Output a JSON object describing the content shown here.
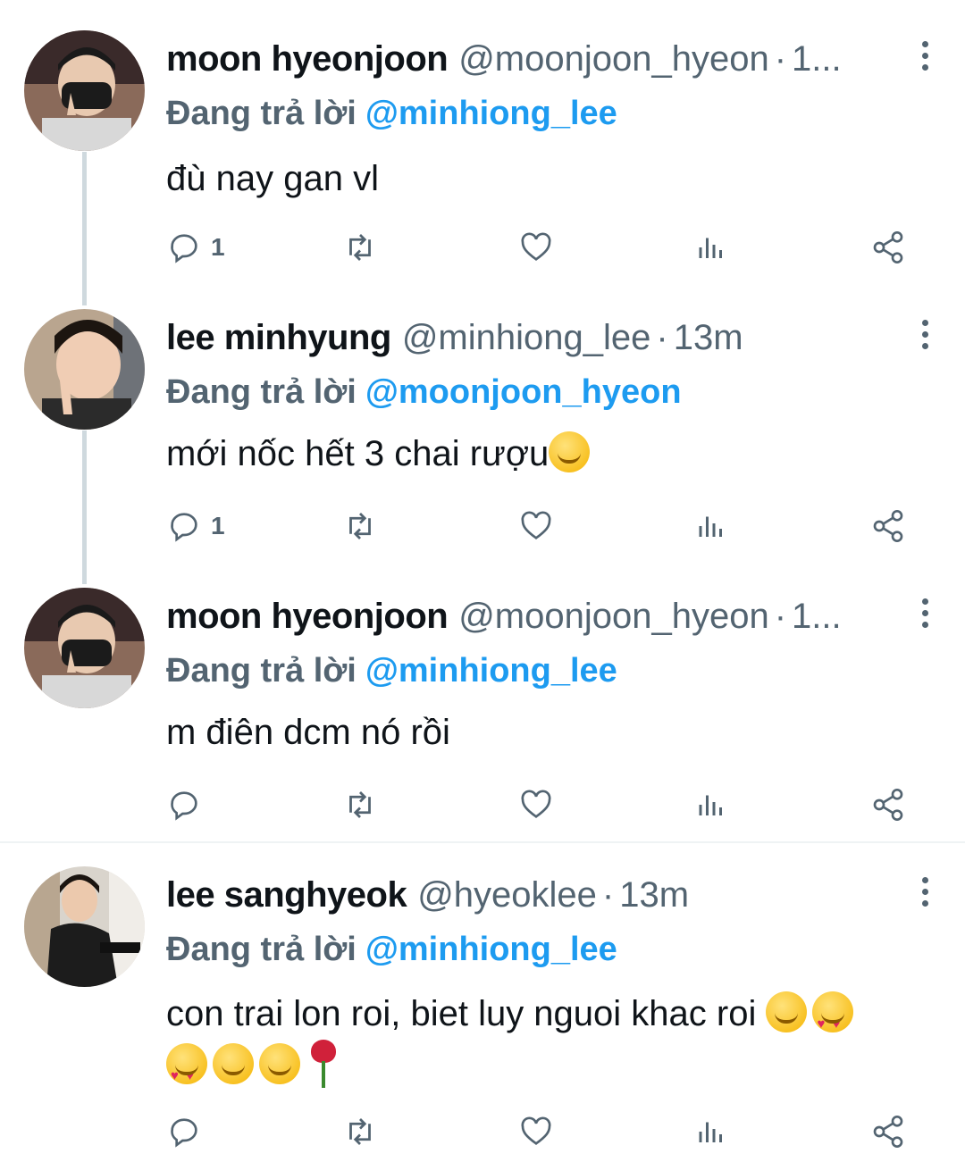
{
  "tweets": [
    {
      "name": "moon hyeonjoon",
      "handle": "@moonjoon_hyeon",
      "time": "1...",
      "reply_prefix": "Đang trả lời",
      "reply_to": "@minhiong_lee",
      "text": "đù nay gan vl",
      "reply_count": "1"
    },
    {
      "name": "lee minhyung",
      "handle": "@minhiong_lee",
      "time": "13m",
      "reply_prefix": "Đang trả lời",
      "reply_to": "@moonjoon_hyeon",
      "text": "mới nốc hết 3 chai rượu",
      "reply_count": "1"
    },
    {
      "name": "moon hyeonjoon",
      "handle": "@moonjoon_hyeon",
      "time": "1...",
      "reply_prefix": "Đang trả lời",
      "reply_to": "@minhiong_lee",
      "text": "m điên dcm nó rồi",
      "reply_count": ""
    },
    {
      "name": "lee sanghyeok",
      "handle": "@hyeoklee",
      "time": "13m",
      "reply_prefix": "Đang trả lời",
      "reply_to": "@minhiong_lee",
      "text": "con trai lon roi, biet luy nguoi khac roi",
      "reply_count": ""
    }
  ],
  "separator": "·",
  "icons": [
    "reply-icon",
    "retweet-icon",
    "like-icon",
    "views-icon",
    "share-icon",
    "more-icon"
  ],
  "colors": {
    "accent": "#1d9bf0",
    "secondary": "#536471",
    "text": "#0f1419"
  }
}
